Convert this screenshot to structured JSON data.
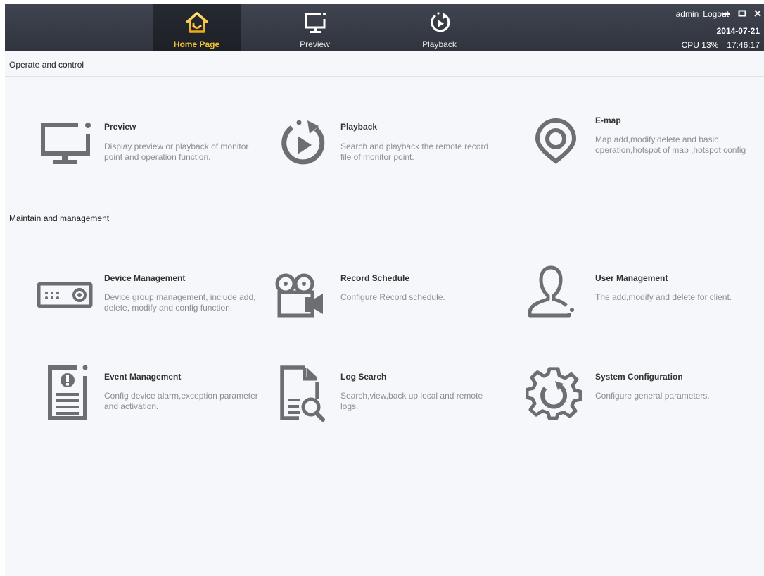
{
  "topbar": {
    "tabs": [
      {
        "label": "Home Page",
        "icon": "home-icon",
        "active": true
      },
      {
        "label": "Preview",
        "icon": "monitor-icon",
        "active": false
      },
      {
        "label": "Playback",
        "icon": "playback-icon",
        "active": false
      }
    ],
    "user": "admin",
    "logout": "Logout",
    "date": "2014-07-21",
    "cpu": "CPU 13%",
    "time": "17:46:17"
  },
  "sections": [
    {
      "title": "Operate and control",
      "cards": [
        {
          "title": "Preview",
          "desc": "Display preview or playback of monitor point and operation function.",
          "icon": "monitor-icon"
        },
        {
          "title": "Playback",
          "desc": "Search and playback the remote record file of monitor point.",
          "icon": "playback-icon"
        },
        {
          "title": "E-map",
          "desc": "Map add,modify,delete and basic operation,hotspot of map ,hotspot config",
          "icon": "map-pin-icon"
        }
      ]
    },
    {
      "title": "Maintain and management",
      "cards": [
        {
          "title": "Device Management",
          "desc": "Device group management, include add, delete, modify and config function.",
          "icon": "device-icon"
        },
        {
          "title": "Record Schedule",
          "desc": "Configure Record schedule.",
          "icon": "video-camera-icon"
        },
        {
          "title": "User Management",
          "desc": "The add,modify and delete for client.",
          "icon": "user-icon"
        },
        {
          "title": "Event Management",
          "desc": "Config device alarm,exception parameter and activation.",
          "icon": "alert-document-icon"
        },
        {
          "title": "Log Search",
          "desc": "Search,view,back up local and remote logs.",
          "icon": "log-search-icon"
        },
        {
          "title": "System Configuration",
          "desc": "Configure general parameters.",
          "icon": "gear-icon"
        }
      ]
    }
  ],
  "colors": {
    "topbar": "#30343d",
    "active_tab_text": "#f3c130",
    "icon_gray": "#6b6e73",
    "background": "#f5f7fa"
  }
}
